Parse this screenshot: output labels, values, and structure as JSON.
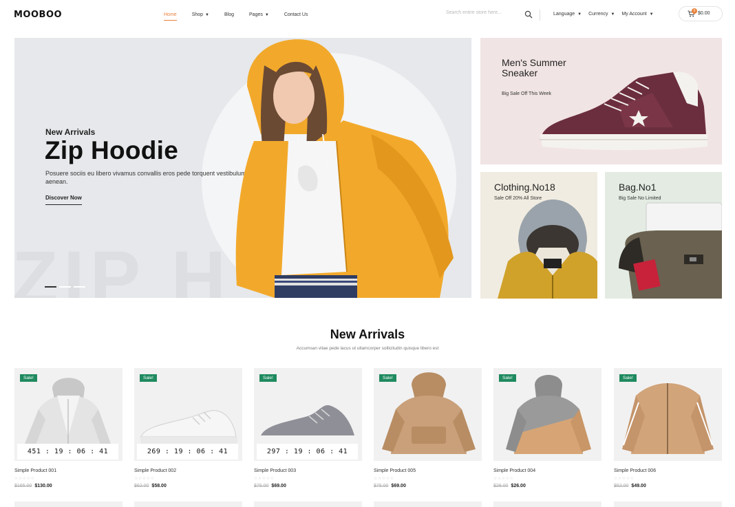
{
  "brand": {
    "name": "MOOBOO"
  },
  "nav": {
    "items": [
      {
        "label": "Home",
        "active": true,
        "dropdown": false
      },
      {
        "label": "Shop",
        "active": false,
        "dropdown": true
      },
      {
        "label": "Blog",
        "active": false,
        "dropdown": false
      },
      {
        "label": "Pages",
        "active": false,
        "dropdown": true
      },
      {
        "label": "Contact Us",
        "active": false,
        "dropdown": false
      }
    ]
  },
  "search": {
    "placeholder": "Search entire store here..."
  },
  "header_links": [
    {
      "label": "Language"
    },
    {
      "label": "Currency"
    },
    {
      "label": "My Account"
    }
  ],
  "cart": {
    "count": "0",
    "total": "$0.00"
  },
  "hero": {
    "kicker": "New Arrivals",
    "title": "Zip Hoodie",
    "description": "Posuere sociis eu libero vivamus convallis eros pede torquent vestibulum aenean.",
    "cta": "Discover Now",
    "watermark": "ZIP H",
    "slides": 3,
    "active_slide": 1
  },
  "banners": [
    {
      "title": "Men's Summer Sneaker",
      "subtitle": "Big Sale Off This Week"
    },
    {
      "title": "Clothing.No18",
      "subtitle": "Sale Off 20% All Store"
    },
    {
      "title": "Bag.No1",
      "subtitle": "Big Sale No Limited"
    }
  ],
  "section": {
    "title": "New Arrivals",
    "subtitle": "Accumsan vitae pede lacus ut ullamcorper sollicitudin quisque libero est"
  },
  "products": [
    {
      "badge": "Sale!",
      "timer": "451 : 19 : 06 : 41",
      "name": "Simple Product 001",
      "rating": "☆☆☆☆☆",
      "old_price": "$165.00",
      "price": "$130.00",
      "icon": "hoodie-white-icon"
    },
    {
      "badge": "Sale!",
      "timer": "269 : 19 : 06 : 41",
      "name": "Simple Product 002",
      "rating": "☆☆☆☆☆",
      "old_price": "$62.00",
      "price": "$58.00",
      "icon": "sneaker-white-icon"
    },
    {
      "badge": "Sale!",
      "timer": "297 : 19 : 06 : 41",
      "name": "Simple Product 003",
      "rating": "☆☆☆☆☆",
      "old_price": "$75.00",
      "price": "$69.00",
      "icon": "sneaker-gray-icon"
    },
    {
      "badge": "Sale!",
      "timer": "",
      "name": "Simple Product 005",
      "rating": "☆☆☆☆☆",
      "old_price": "$75.00",
      "price": "$69.00",
      "icon": "hoodie-tan-icon"
    },
    {
      "badge": "Sale!",
      "timer": "",
      "name": "Simple Product 004",
      "rating": "☆☆☆☆☆",
      "old_price": "$28.00",
      "price": "$26.00",
      "icon": "hoodie-gray-icon"
    },
    {
      "badge": "Sale!",
      "timer": "",
      "name": "Simple Product 006",
      "rating": "☆☆☆☆☆",
      "old_price": "$52.00",
      "price": "$49.00",
      "icon": "jacket-tan-icon"
    }
  ],
  "colors": {
    "accent": "#e8813a",
    "sale_badge": "#1f8a5f",
    "hoodie": "#f2a92b"
  }
}
